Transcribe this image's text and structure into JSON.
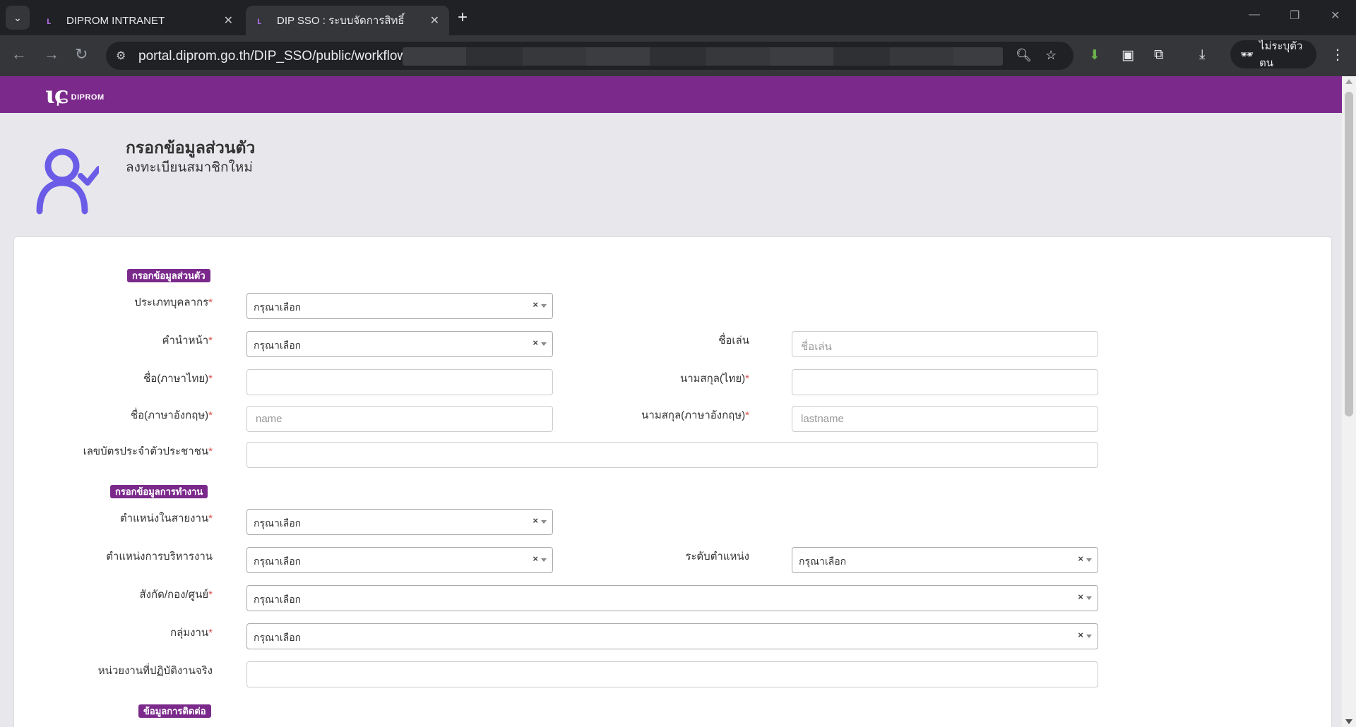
{
  "browser": {
    "tabs": [
      {
        "title": "DIPROM INTRANET",
        "active": false
      },
      {
        "title": "DIP SSO : ระบบจัดการสิทธิ์",
        "active": true
      }
    ],
    "url": "portal.diprom.go.th/DIP_SSO/public/workflow.ph",
    "profile_label": "ไม่ระบุตัวตน"
  },
  "brand": {
    "logo_text": "DIPROM",
    "bar_color": "#7b2a8c"
  },
  "heading": {
    "title": "กรอกข้อมูลส่วนตัว",
    "subtitle": "ลงทะเบียนสมาชิกใหม่"
  },
  "sections": {
    "personal": "กรอกข้อมูลส่วนตัว",
    "work": "กรอกข้อมูลการทำงาน",
    "contact": "ข้อมูลการติดต่อ"
  },
  "form": {
    "personnel_type": {
      "label": "ประเภทบุคลากร",
      "value": "กรุณาเลือก"
    },
    "prefix": {
      "label": "คำนำหน้า",
      "value": "กรุณาเลือก"
    },
    "nickname": {
      "label": "ชื่อเล่น",
      "placeholder": "ชื่อเล่น"
    },
    "firstname_th": {
      "label": "ชื่อ(ภาษาไทย)"
    },
    "lastname_th": {
      "label": "นามสกุล(ไทย)"
    },
    "firstname_en": {
      "label": "ชื่อ(ภาษาอังกฤษ)",
      "placeholder": "name"
    },
    "lastname_en": {
      "label": "นามสกุล(ภาษาอังกฤษ)",
      "placeholder": "lastname"
    },
    "id_card": {
      "label": "เลขบัตรประจำตัวประชาชน"
    },
    "line_position": {
      "label": "ตำแหน่งในสายงาน",
      "value": "กรุณาเลือก"
    },
    "admin_position": {
      "label": "ตำแหน่งการบริหารงาน",
      "value": "กรุณาเลือก"
    },
    "position_level": {
      "label": "ระดับตำแหน่ง",
      "value": "กรุณาเลือก"
    },
    "department": {
      "label": "สังกัด/กอง/ศูนย์",
      "value": "กรุณาเลือก"
    },
    "workgroup": {
      "label": "กลุ่มงาน",
      "value": "กรุณาเลือก"
    },
    "actual_unit": {
      "label": "หน่วยงานที่ปฏิบัติงานจริง"
    }
  },
  "required_mark": "*",
  "clear_mark": "×"
}
